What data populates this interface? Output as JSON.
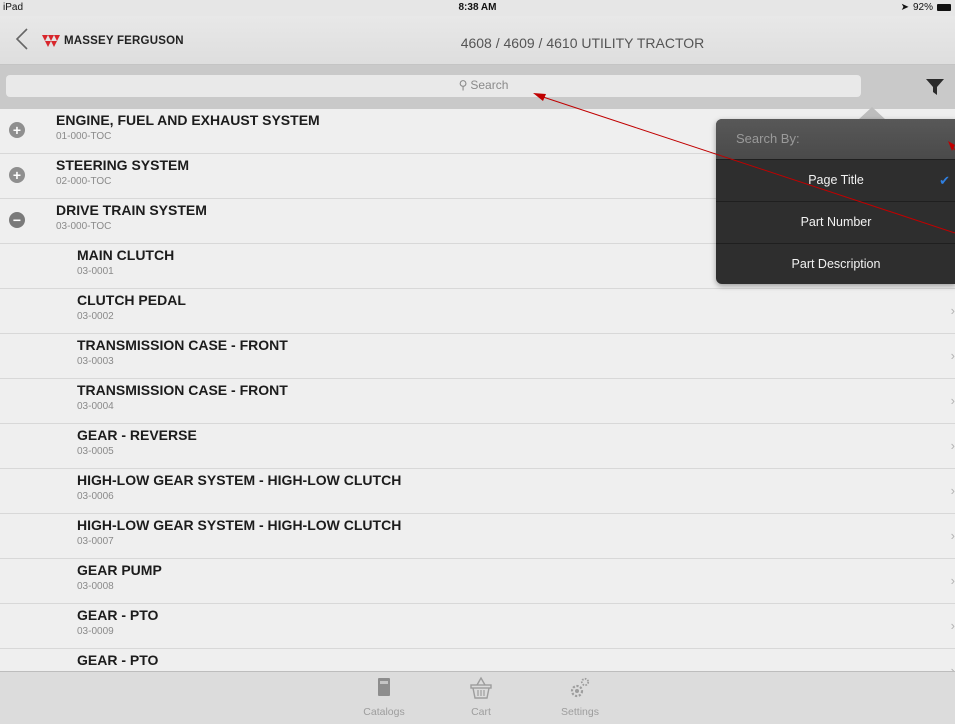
{
  "status_bar": {
    "device": "iPad",
    "time": "8:38 AM",
    "battery": "92%"
  },
  "nav": {
    "brand": "MASSEY FERGUSON",
    "title": "4608 / 4609 / 4610 UTILITY TRACTOR"
  },
  "search": {
    "placeholder": "Search"
  },
  "popover": {
    "header": "Search By:",
    "options": [
      {
        "label": "Page Title",
        "selected": true
      },
      {
        "label": "Part Number",
        "selected": false
      },
      {
        "label": "Part Description",
        "selected": false
      }
    ]
  },
  "list": {
    "sections": [
      {
        "title": "ENGINE, FUEL AND EXHAUST SYSTEM",
        "code": "01-000-TOC",
        "expanded": false
      },
      {
        "title": "STEERING SYSTEM",
        "code": "02-000-TOC",
        "expanded": false
      },
      {
        "title": "DRIVE TRAIN SYSTEM",
        "code": "03-000-TOC",
        "expanded": true
      }
    ],
    "items": [
      {
        "title": "MAIN CLUTCH",
        "code": "03-0001"
      },
      {
        "title": "CLUTCH PEDAL",
        "code": "03-0002"
      },
      {
        "title": "TRANSMISSION CASE - FRONT",
        "code": "03-0003"
      },
      {
        "title": "TRANSMISSION CASE - FRONT",
        "code": "03-0004"
      },
      {
        "title": "GEAR - REVERSE",
        "code": "03-0005"
      },
      {
        "title": "HIGH-LOW GEAR SYSTEM - HIGH-LOW CLUTCH",
        "code": "03-0006"
      },
      {
        "title": "HIGH-LOW GEAR SYSTEM - HIGH-LOW CLUTCH",
        "code": "03-0007"
      },
      {
        "title": "GEAR PUMP",
        "code": "03-0008"
      },
      {
        "title": "GEAR - PTO",
        "code": "03-0009"
      },
      {
        "title": "GEAR - PTO",
        "code": ""
      }
    ]
  },
  "tabs": [
    {
      "label": "Catalogs",
      "icon": "book-icon"
    },
    {
      "label": "Cart",
      "icon": "basket-icon"
    },
    {
      "label": "Settings",
      "icon": "gears-icon"
    }
  ],
  "colors": {
    "annotation_arrow": "#c00000",
    "checkmark": "#2f7fe0",
    "brand_red": "#d8262c"
  }
}
